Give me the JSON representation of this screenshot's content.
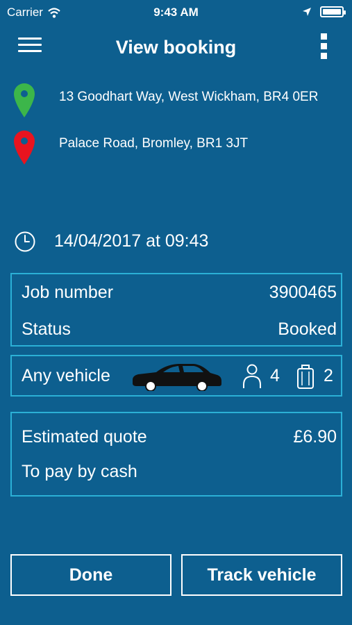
{
  "status_bar": {
    "carrier": "Carrier",
    "time": "9:43 AM",
    "icons": [
      "wifi-icon",
      "location-arrow-icon",
      "battery-icon"
    ]
  },
  "nav": {
    "title": "View booking",
    "menu_icon": "hamburger-menu-icon",
    "more_icon": "more-vertical-icon"
  },
  "route": {
    "pickup": {
      "address": "13 Goodhart Way, West Wickham, BR4 0ER",
      "icon": "green-pin-icon",
      "color": "#3cb64a"
    },
    "dropoff": {
      "address": "Palace Road, Bromley, BR1 3JT",
      "icon": "red-pin-icon",
      "color": "#e8141f"
    }
  },
  "datetime": {
    "icon": "clock-icon",
    "text": "14/04/2017 at 09:43"
  },
  "job": {
    "number_label": "Job number",
    "number_value": "3900465",
    "status_label": "Status",
    "status_value": "Booked"
  },
  "vehicle": {
    "type": "Any vehicle",
    "car_icon": "car-icon",
    "passenger_icon": "passenger-icon",
    "passengers": "4",
    "luggage_icon": "luggage-icon",
    "luggage": "2"
  },
  "quote": {
    "label": "Estimated quote",
    "value": "£6.90",
    "payment": "To pay by cash"
  },
  "actions": {
    "done": "Done",
    "track": "Track vehicle"
  },
  "colors": {
    "background": "#0d5f8f",
    "card_border": "#2bb0d6",
    "text": "#ffffff"
  }
}
